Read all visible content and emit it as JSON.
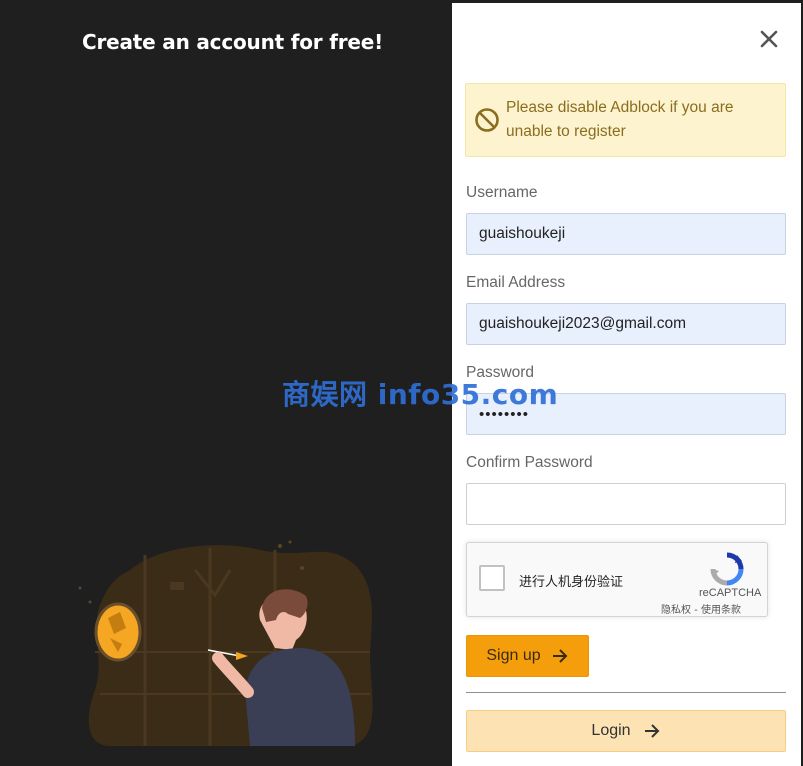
{
  "left": {
    "title": "Create an account for free!"
  },
  "notice": {
    "icon": "no-entry-icon",
    "text": "Please disable Adblock if you are unable to register"
  },
  "form": {
    "username_label": "Username",
    "username_value": "guaishoukeji",
    "email_label": "Email Address",
    "email_value": "guaishoukeji2023@gmail.com",
    "password_label": "Password",
    "password_value": "••••••••",
    "confirm_label": "Confirm Password",
    "confirm_value": ""
  },
  "captcha": {
    "label": "进行人机身份验证",
    "brand": "reCAPTCHA",
    "links": "隐私权 - 使用条款"
  },
  "buttons": {
    "signup_label": "Sign up",
    "login_label": "Login"
  },
  "watermark": "商娱网 info35.com",
  "colors": {
    "left_bg": "#1f1f1f",
    "accent": "#f59e0b",
    "login_bg": "#fde3b3",
    "notice_bg": "#fdf3cf",
    "input_autofill_bg": "#e8f0fe",
    "watermark": "#2f6fd6"
  }
}
